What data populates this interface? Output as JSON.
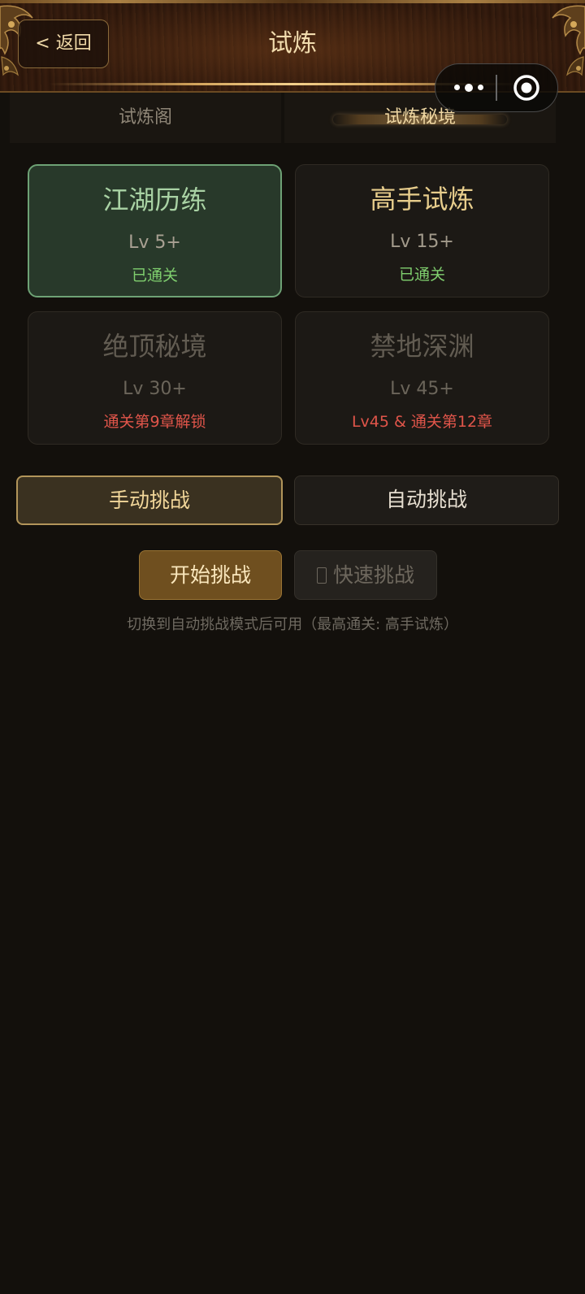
{
  "header": {
    "back_label": "< 返回",
    "title": "试炼"
  },
  "capsule": {
    "more_icon": "more-dots-icon",
    "close_icon": "target-circle-icon"
  },
  "tabs": [
    {
      "label": "试炼阁",
      "active": false
    },
    {
      "label": "试炼秘境",
      "active": true
    }
  ],
  "stages": [
    {
      "name": "江湖历练",
      "level": "Lv 5+",
      "status": "已通关",
      "state": "selected-cleared"
    },
    {
      "name": "高手试炼",
      "level": "Lv 15+",
      "status": "已通关",
      "state": "cleared"
    },
    {
      "name": "绝顶秘境",
      "level": "Lv 30+",
      "status": "通关第9章解锁",
      "state": "locked"
    },
    {
      "name": "禁地深渊",
      "level": "Lv 45+",
      "status": "Lv45 & 通关第12章",
      "state": "locked"
    }
  ],
  "modes": {
    "manual_label": "手动挑战",
    "auto_label": "自动挑战",
    "selected": "manual"
  },
  "actions": {
    "start_label": "开始挑战",
    "quick_label": "快速挑战",
    "quick_icon": "lock-icon",
    "quick_enabled": false
  },
  "hint": "切换到自动挑战模式后可用（最高通关: 高手试炼）",
  "colors": {
    "background": "#13100c",
    "accent_gold": "#f2d79a",
    "cleared_green": "#7fcf6e",
    "locked_red": "#e0554a",
    "selected_card_border": "#6ea275"
  }
}
